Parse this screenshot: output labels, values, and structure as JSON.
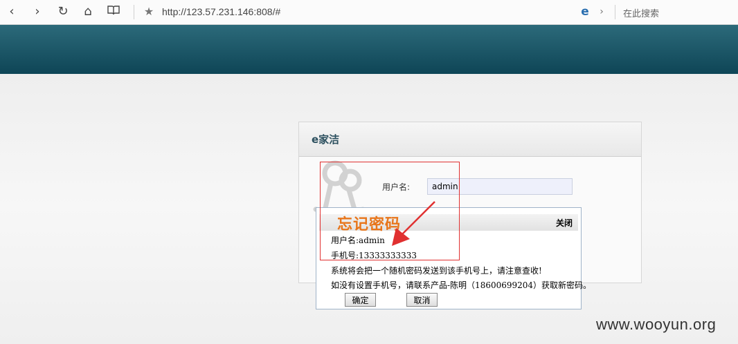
{
  "browser": {
    "url": "http://123.57.231.146:808/#",
    "search_placeholder": "在此搜索"
  },
  "login": {
    "title": "e家洁",
    "username_label": "用户名:",
    "username_value": "admin"
  },
  "forgot_dialog": {
    "title": "忘记密码",
    "close_label": "关闭",
    "username_line": "用户名:admin",
    "phone_line": "手机号:13333333333",
    "notice_line": "系统将会把一个随机密码发送到该手机号上，请注意查收!",
    "contact_line": "如没有设置手机号，请联系产品-陈明（18600699204）获取新密码。",
    "confirm_label": "确定",
    "cancel_label": "取消"
  },
  "watermark": "www.wooyun.org",
  "colors": {
    "banner_top": "#2c6a7a",
    "banner_bottom": "#0e4556",
    "annotation": "#e03030",
    "dialog_title": "#e8751a"
  }
}
